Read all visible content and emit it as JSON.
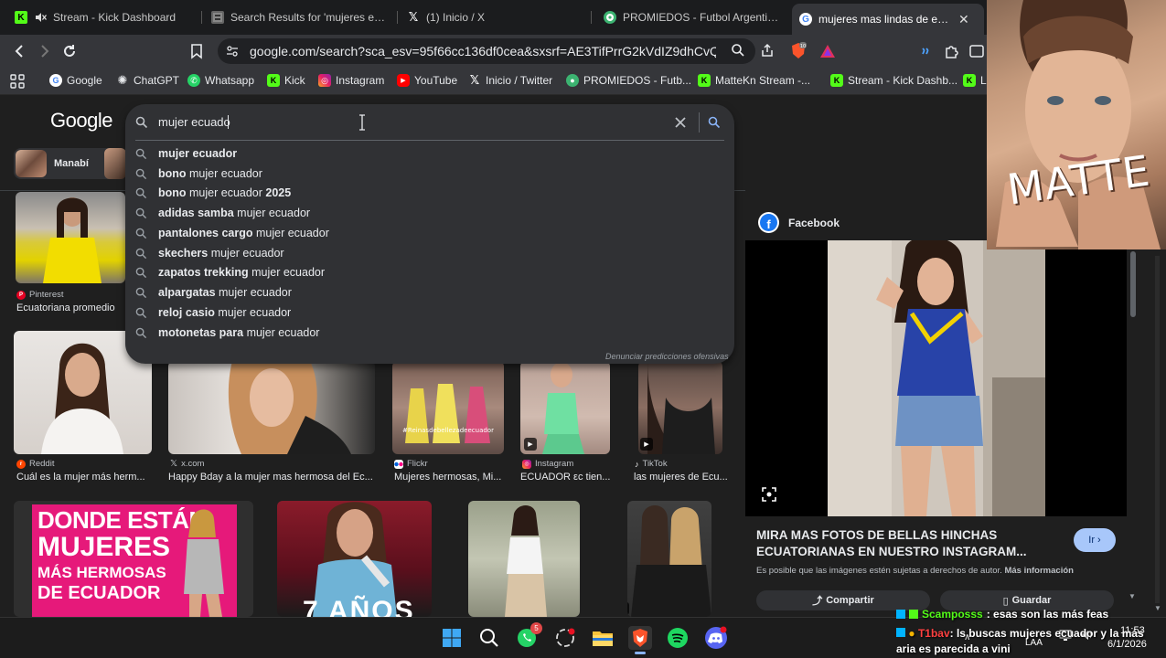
{
  "tabs": [
    {
      "title": "Stream - Kick Dashboard",
      "favicon": "kick-icon",
      "color": "#53fc18"
    },
    {
      "title": "Search Results for 'mujeres ecuad",
      "favicon": "page-icon",
      "color": "#555"
    },
    {
      "title": "(1) Inicio / X",
      "favicon": "x-icon",
      "color": "#000"
    },
    {
      "title": "PROMIEDOS - Futbol Argentino -",
      "favicon": "soccer-icon",
      "color": "#3cb371"
    },
    {
      "title": "mujeres mas lindas de ecuad",
      "favicon": "google-icon",
      "color": "#fff",
      "active": true
    }
  ],
  "address_bar": {
    "url": "google.com/search?sca_esv=95f66cc136df0cea&sxsrf=AE3TifPrrG2kVdIZ9dhCvQfZP8p..."
  },
  "bookmarks": [
    {
      "label": "Google",
      "icon": "google-icon"
    },
    {
      "label": "ChatGPT",
      "icon": "chatgpt-icon"
    },
    {
      "label": "Whatsapp",
      "icon": "whatsapp-icon"
    },
    {
      "label": "Kick",
      "icon": "kick-icon"
    },
    {
      "label": "Instagram",
      "icon": "instagram-icon"
    },
    {
      "label": "YouTube",
      "icon": "youtube-icon"
    },
    {
      "label": "Inicio / Twitter",
      "icon": "x-icon"
    },
    {
      "label": "PROMIEDOS - Futb...",
      "icon": "soccer-icon"
    },
    {
      "label": "MatteKn Stream -...",
      "icon": "kick-icon"
    },
    {
      "label": "Stream - Kick Dashb...",
      "icon": "kick-icon"
    },
    {
      "label": "L",
      "icon": "kick-icon"
    }
  ],
  "google": {
    "logo": "Google",
    "query": "mujer ecuado",
    "chip_label": "Manabí",
    "suggestions": [
      {
        "bold": "",
        "normal": "mujer ecuador"
      },
      {
        "bold": "bono",
        "normal": " mujer ecuador"
      },
      {
        "bold": "bono",
        "normal": " mujer ecuador ",
        "bold2": "2025"
      },
      {
        "bold": "adidas samba",
        "normal": " mujer ecuador"
      },
      {
        "bold": "pantalones cargo",
        "normal": " mujer ecuador"
      },
      {
        "bold": "skechers",
        "normal": " mujer ecuador"
      },
      {
        "bold": "zapatos trekking",
        "normal": " mujer ecuador"
      },
      {
        "bold": "alpargatas",
        "normal": " mujer ecuador"
      },
      {
        "bold": "reloj casio",
        "normal": " mujer ecuador"
      },
      {
        "bold": "motonetas para",
        "normal": " mujer ecuador"
      }
    ],
    "report_link": "Denunciar predicciones ofensivas"
  },
  "results": [
    {
      "source": "Pinterest",
      "caption": "Ecuatoriana promedio"
    },
    {
      "source": "Reddit",
      "caption": "Cuál es la mujer más herm..."
    },
    {
      "source": "x.com",
      "caption": "Happy Bday a la mujer mas hermosa del Ec..."
    },
    {
      "source": "Flickr",
      "caption": "Mujeres hermosas, Mi..."
    },
    {
      "source": "Instagram",
      "caption": "ECUADOR εc tien..."
    },
    {
      "source": "TikTok",
      "caption": "las mujeres de Ecu..."
    }
  ],
  "banner": {
    "line1": "DONDE ESTÁN",
    "line2": "MUJERES",
    "line3": "MÁS HERMOSAS",
    "line4": "DE ECUADOR"
  },
  "thumb_text": "7 AÑOS",
  "thumb_watermark": "#Reinasdebellezadeecuador",
  "panel": {
    "source": "Facebook",
    "title": "MIRA MAS FOTOS DE BELLAS HINCHAS ECUATORIANAS EN NUESTRO INSTAGRAM...",
    "go_button": "Ir",
    "note": "Es posible que las imágenes estén sujetas a derechos de autor.",
    "more_info": "Más información",
    "share_button": "Compartir",
    "save_button": "Guardar"
  },
  "webcam_text": "MATTE",
  "chat": [
    {
      "user": "Scamposss",
      "user_color": "#53fc18",
      "message": ": esas son las más feas"
    },
    {
      "user": "T1bav",
      "user_color": "#ff4040",
      "message": ": ls buscas mujeres ecuador y la más aria es parecida a vini"
    }
  ],
  "taskbar": {
    "whatsapp_badge": "5",
    "region": "LAA",
    "date": "6/1/2026",
    "time": "11:53"
  }
}
